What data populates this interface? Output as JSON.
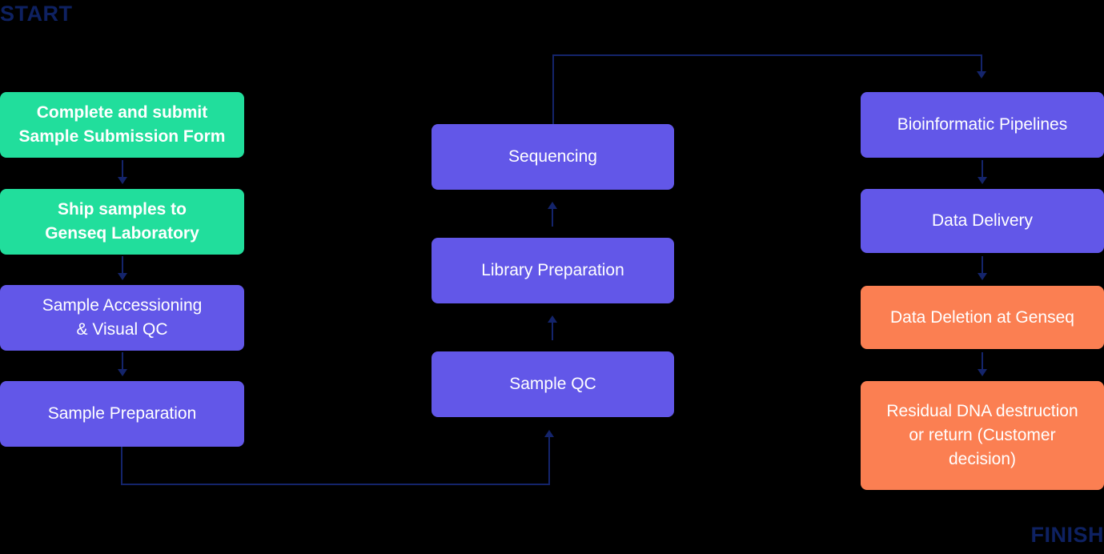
{
  "diagram": {
    "title_markers": {
      "start": "START",
      "finish": "FINISH"
    },
    "colors": {
      "background": "#000000",
      "green": "#21DE9C",
      "purple": "#6257E8",
      "orange": "#FB7F52",
      "navy": "#14246B",
      "marker_text": "#0E2161",
      "node_text": "#FFFFFF"
    },
    "columns": [
      {
        "name": "customer-and-intake",
        "nodes": [
          {
            "id": "complete-submit-form",
            "label": "Complete and submit\nSample Submission Form",
            "color": "green"
          },
          {
            "id": "ship-samples",
            "label": "Ship samples to\nGenseq Laboratory",
            "color": "green"
          },
          {
            "id": "sample-accessioning",
            "label": "Sample Accessioning\n& Visual QC",
            "color": "purple"
          },
          {
            "id": "sample-preparation",
            "label": "Sample Preparation",
            "color": "purple"
          }
        ]
      },
      {
        "name": "laboratory-processing",
        "nodes": [
          {
            "id": "sequencing",
            "label": "Sequencing",
            "color": "purple"
          },
          {
            "id": "library-preparation",
            "label": "Library Preparation",
            "color": "purple"
          },
          {
            "id": "sample-qc",
            "label": "Sample QC",
            "color": "purple"
          }
        ]
      },
      {
        "name": "analysis-and-disposal",
        "nodes": [
          {
            "id": "bioinformatic-pipelines",
            "label": "Bioinformatic Pipelines",
            "color": "purple"
          },
          {
            "id": "data-delivery",
            "label": "Data Delivery",
            "color": "purple"
          },
          {
            "id": "data-deletion",
            "label": "Data Deletion at Genseq",
            "color": "orange"
          },
          {
            "id": "residual-dna",
            "label": "Residual DNA destruction\nor return (Customer\ndecision)",
            "color": "orange"
          }
        ]
      }
    ],
    "connectors": [
      {
        "id": "c1",
        "from": "complete-submit-form",
        "to": "ship-samples",
        "direction": "down"
      },
      {
        "id": "c2",
        "from": "ship-samples",
        "to": "sample-accessioning",
        "direction": "down"
      },
      {
        "id": "c3",
        "from": "sample-accessioning",
        "to": "sample-preparation",
        "direction": "down"
      },
      {
        "id": "c4",
        "from": "sample-preparation",
        "to": "sample-qc",
        "direction": "elbow-up-right"
      },
      {
        "id": "c5",
        "from": "sample-qc",
        "to": "library-preparation",
        "direction": "up"
      },
      {
        "id": "c6",
        "from": "library-preparation",
        "to": "sequencing",
        "direction": "up"
      },
      {
        "id": "c7",
        "from": "sequencing",
        "to": "bioinformatic-pipelines",
        "direction": "elbow-up-right-down"
      },
      {
        "id": "c8",
        "from": "bioinformatic-pipelines",
        "to": "data-delivery",
        "direction": "down"
      },
      {
        "id": "c9",
        "from": "data-delivery",
        "to": "data-deletion",
        "direction": "down"
      },
      {
        "id": "c10",
        "from": "data-deletion",
        "to": "residual-dna",
        "direction": "down"
      }
    ]
  }
}
